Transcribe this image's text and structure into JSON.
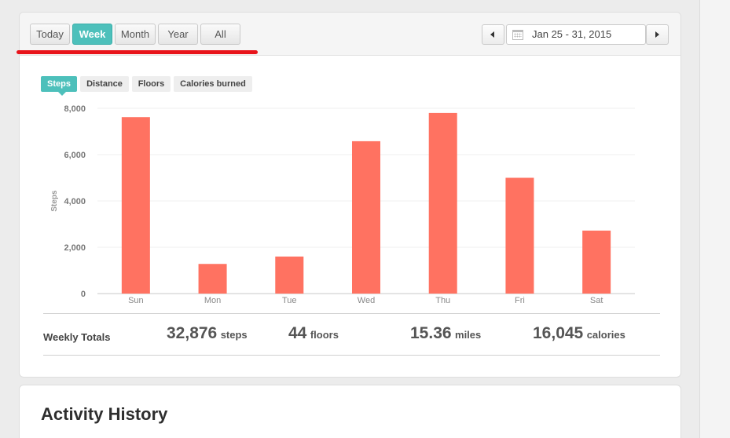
{
  "range_buttons": [
    {
      "label": "Today",
      "active": false
    },
    {
      "label": "Week",
      "active": true
    },
    {
      "label": "Month",
      "active": false
    },
    {
      "label": "Year",
      "active": false
    },
    {
      "label": "All",
      "active": false
    }
  ],
  "date_range": "Jan 25 - 31, 2015",
  "metric_tabs": [
    {
      "label": "Steps",
      "active": true
    },
    {
      "label": "Distance",
      "active": false
    },
    {
      "label": "Floors",
      "active": false
    },
    {
      "label": "Calories burned",
      "active": false
    }
  ],
  "chart_data": {
    "type": "bar",
    "categories": [
      "Sun",
      "Mon",
      "Tue",
      "Wed",
      "Thu",
      "Fri",
      "Sat"
    ],
    "values": [
      7620,
      1280,
      1600,
      6580,
      7800,
      5000,
      2720
    ],
    "ylabel": "Steps",
    "ylim": [
      0,
      8000
    ],
    "yticks": [
      "0",
      "2,000",
      "4,000",
      "6,000",
      "8,000"
    ],
    "ytick_values": [
      0,
      2000,
      4000,
      6000,
      8000
    ],
    "bar_color": "#ff7261",
    "grid": true
  },
  "totals": {
    "label": "Weekly Totals",
    "steps": {
      "value": "32,876",
      "unit": "steps"
    },
    "floors": {
      "value": "44",
      "unit": "floors"
    },
    "miles": {
      "value": "15.36",
      "unit": "miles"
    },
    "calories": {
      "value": "16,045",
      "unit": "calories"
    }
  },
  "activity_history_title": "Activity History",
  "colors": {
    "accent": "#4dc0bb",
    "highlight_underline": "#e8141b"
  }
}
